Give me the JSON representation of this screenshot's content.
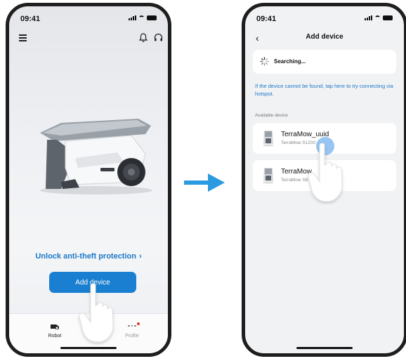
{
  "left_screen": {
    "status_time": "09:41",
    "unlock_link": "Unlock anti-theft protection",
    "add_device_button": "Add device",
    "tabs": [
      {
        "label": "Robot"
      },
      {
        "label": "Profile"
      }
    ]
  },
  "right_screen": {
    "status_time": "09:41",
    "title": "Add device",
    "searching_text": "Searching...",
    "hotspot_link": "If the device cannot be found, tap here to try connecting via hotspot.",
    "section_label": "Available device",
    "devices": [
      {
        "name": "TerraMow_uuid",
        "model": "TerraMow S1200"
      },
      {
        "name": "TerraMow",
        "model": "TerraMow S8"
      }
    ]
  },
  "colors": {
    "accent": "#1a7fd0",
    "arrow": "#2a9be0",
    "notification_dot": "#e53935"
  },
  "icons": [
    "menu-icon",
    "bell-icon",
    "headset-icon",
    "back-icon",
    "spinner-icon",
    "robot-tab-icon",
    "profile-tab-icon",
    "pointing-hand-icon",
    "arrow-right-icon"
  ]
}
